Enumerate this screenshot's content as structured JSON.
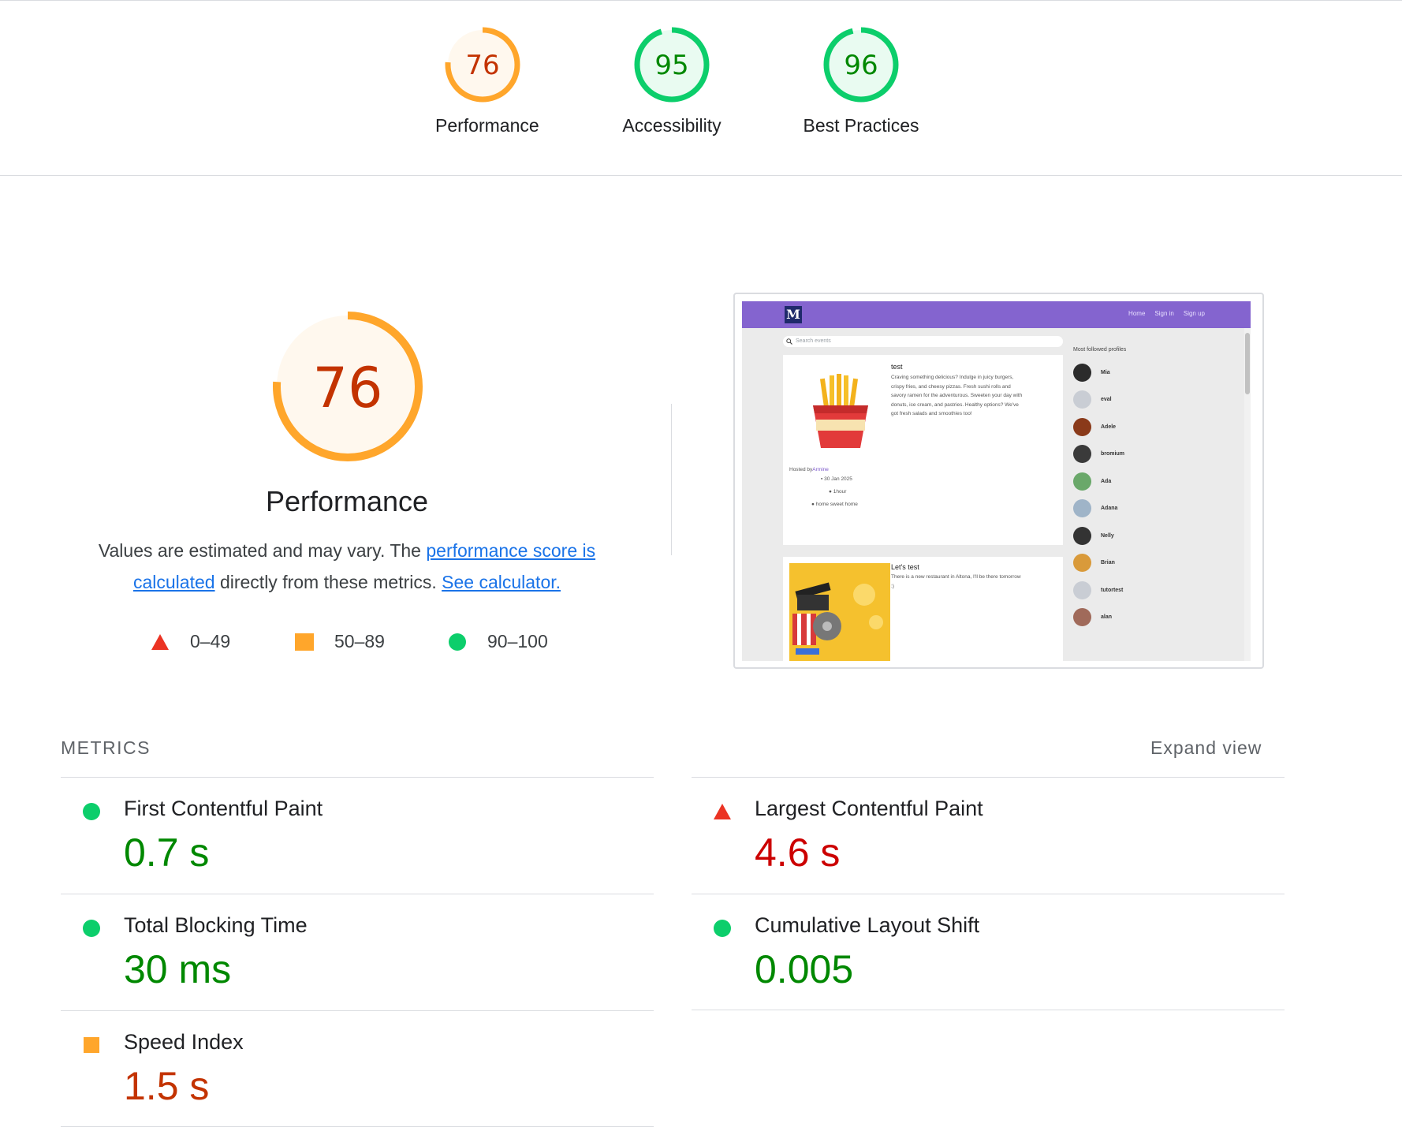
{
  "header_scores": [
    {
      "label": "Performance",
      "score": 76,
      "status": "average"
    },
    {
      "label": "Accessibility",
      "score": 95,
      "status": "pass"
    },
    {
      "label": "Best Practices",
      "score": 96,
      "status": "pass"
    }
  ],
  "performance": {
    "score": 76,
    "title": "Performance",
    "desc_pre": "Values are estimated and may vary. The ",
    "link1": "performance score is calculated",
    "desc_mid": " directly from these metrics. ",
    "link2": "See calculator."
  },
  "legend": [
    {
      "shape": "triangle",
      "range": "0–49"
    },
    {
      "shape": "square",
      "range": "50–89"
    },
    {
      "shape": "circle",
      "range": "90–100"
    }
  ],
  "colors": {
    "fail": "#eb3323",
    "average": "#ffa62b",
    "pass": "#0cce6b",
    "fail_text": "#cc0000",
    "average_text": "#c33300",
    "pass_text": "#008800",
    "average_bg": "#fff8ee",
    "pass_bg": "#e9fbf1",
    "link": "#1a73e8"
  },
  "screenshot": {
    "nav_links": [
      "Home",
      "Sign in",
      "Sign up"
    ],
    "search_placeholder": "Search events",
    "card1": {
      "title": "test",
      "text": "Craving something delicious? Indulge in juicy burgers, crispy fries, and cheesy pizzas. Fresh sushi rolls and savory ramen for the adventurous. Sweeten your day with donuts, ice cream, and pastries. Healthy options? We've got fresh salads and smoothies too!",
      "hosted_prefix": "Hosted by",
      "host": "Armine",
      "date": "30 Jan 2025",
      "duration": "1hour",
      "location": "home sweet home"
    },
    "card2": {
      "title": "Let's test",
      "text": "There is a new restaurant in Altona, I'll be there tomorrow :)"
    },
    "sidebar_title": "Most followed profiles",
    "profiles": [
      "Mia",
      "eval",
      "Adele",
      "bromium",
      "Ada",
      "Adana",
      "Nelly",
      "Brian",
      "tutortest",
      "alan"
    ]
  },
  "metrics": {
    "heading": "METRICS",
    "expand_label": "Expand view",
    "items": [
      {
        "label": "First Contentful Paint",
        "value": "0.7 s",
        "status": "pass"
      },
      {
        "label": "Largest Contentful Paint",
        "value": "4.6 s",
        "status": "fail"
      },
      {
        "label": "Total Blocking Time",
        "value": "30 ms",
        "status": "pass"
      },
      {
        "label": "Cumulative Layout Shift",
        "value": "0.005",
        "status": "pass"
      },
      {
        "label": "Speed Index",
        "value": "1.5 s",
        "status": "average"
      }
    ]
  }
}
